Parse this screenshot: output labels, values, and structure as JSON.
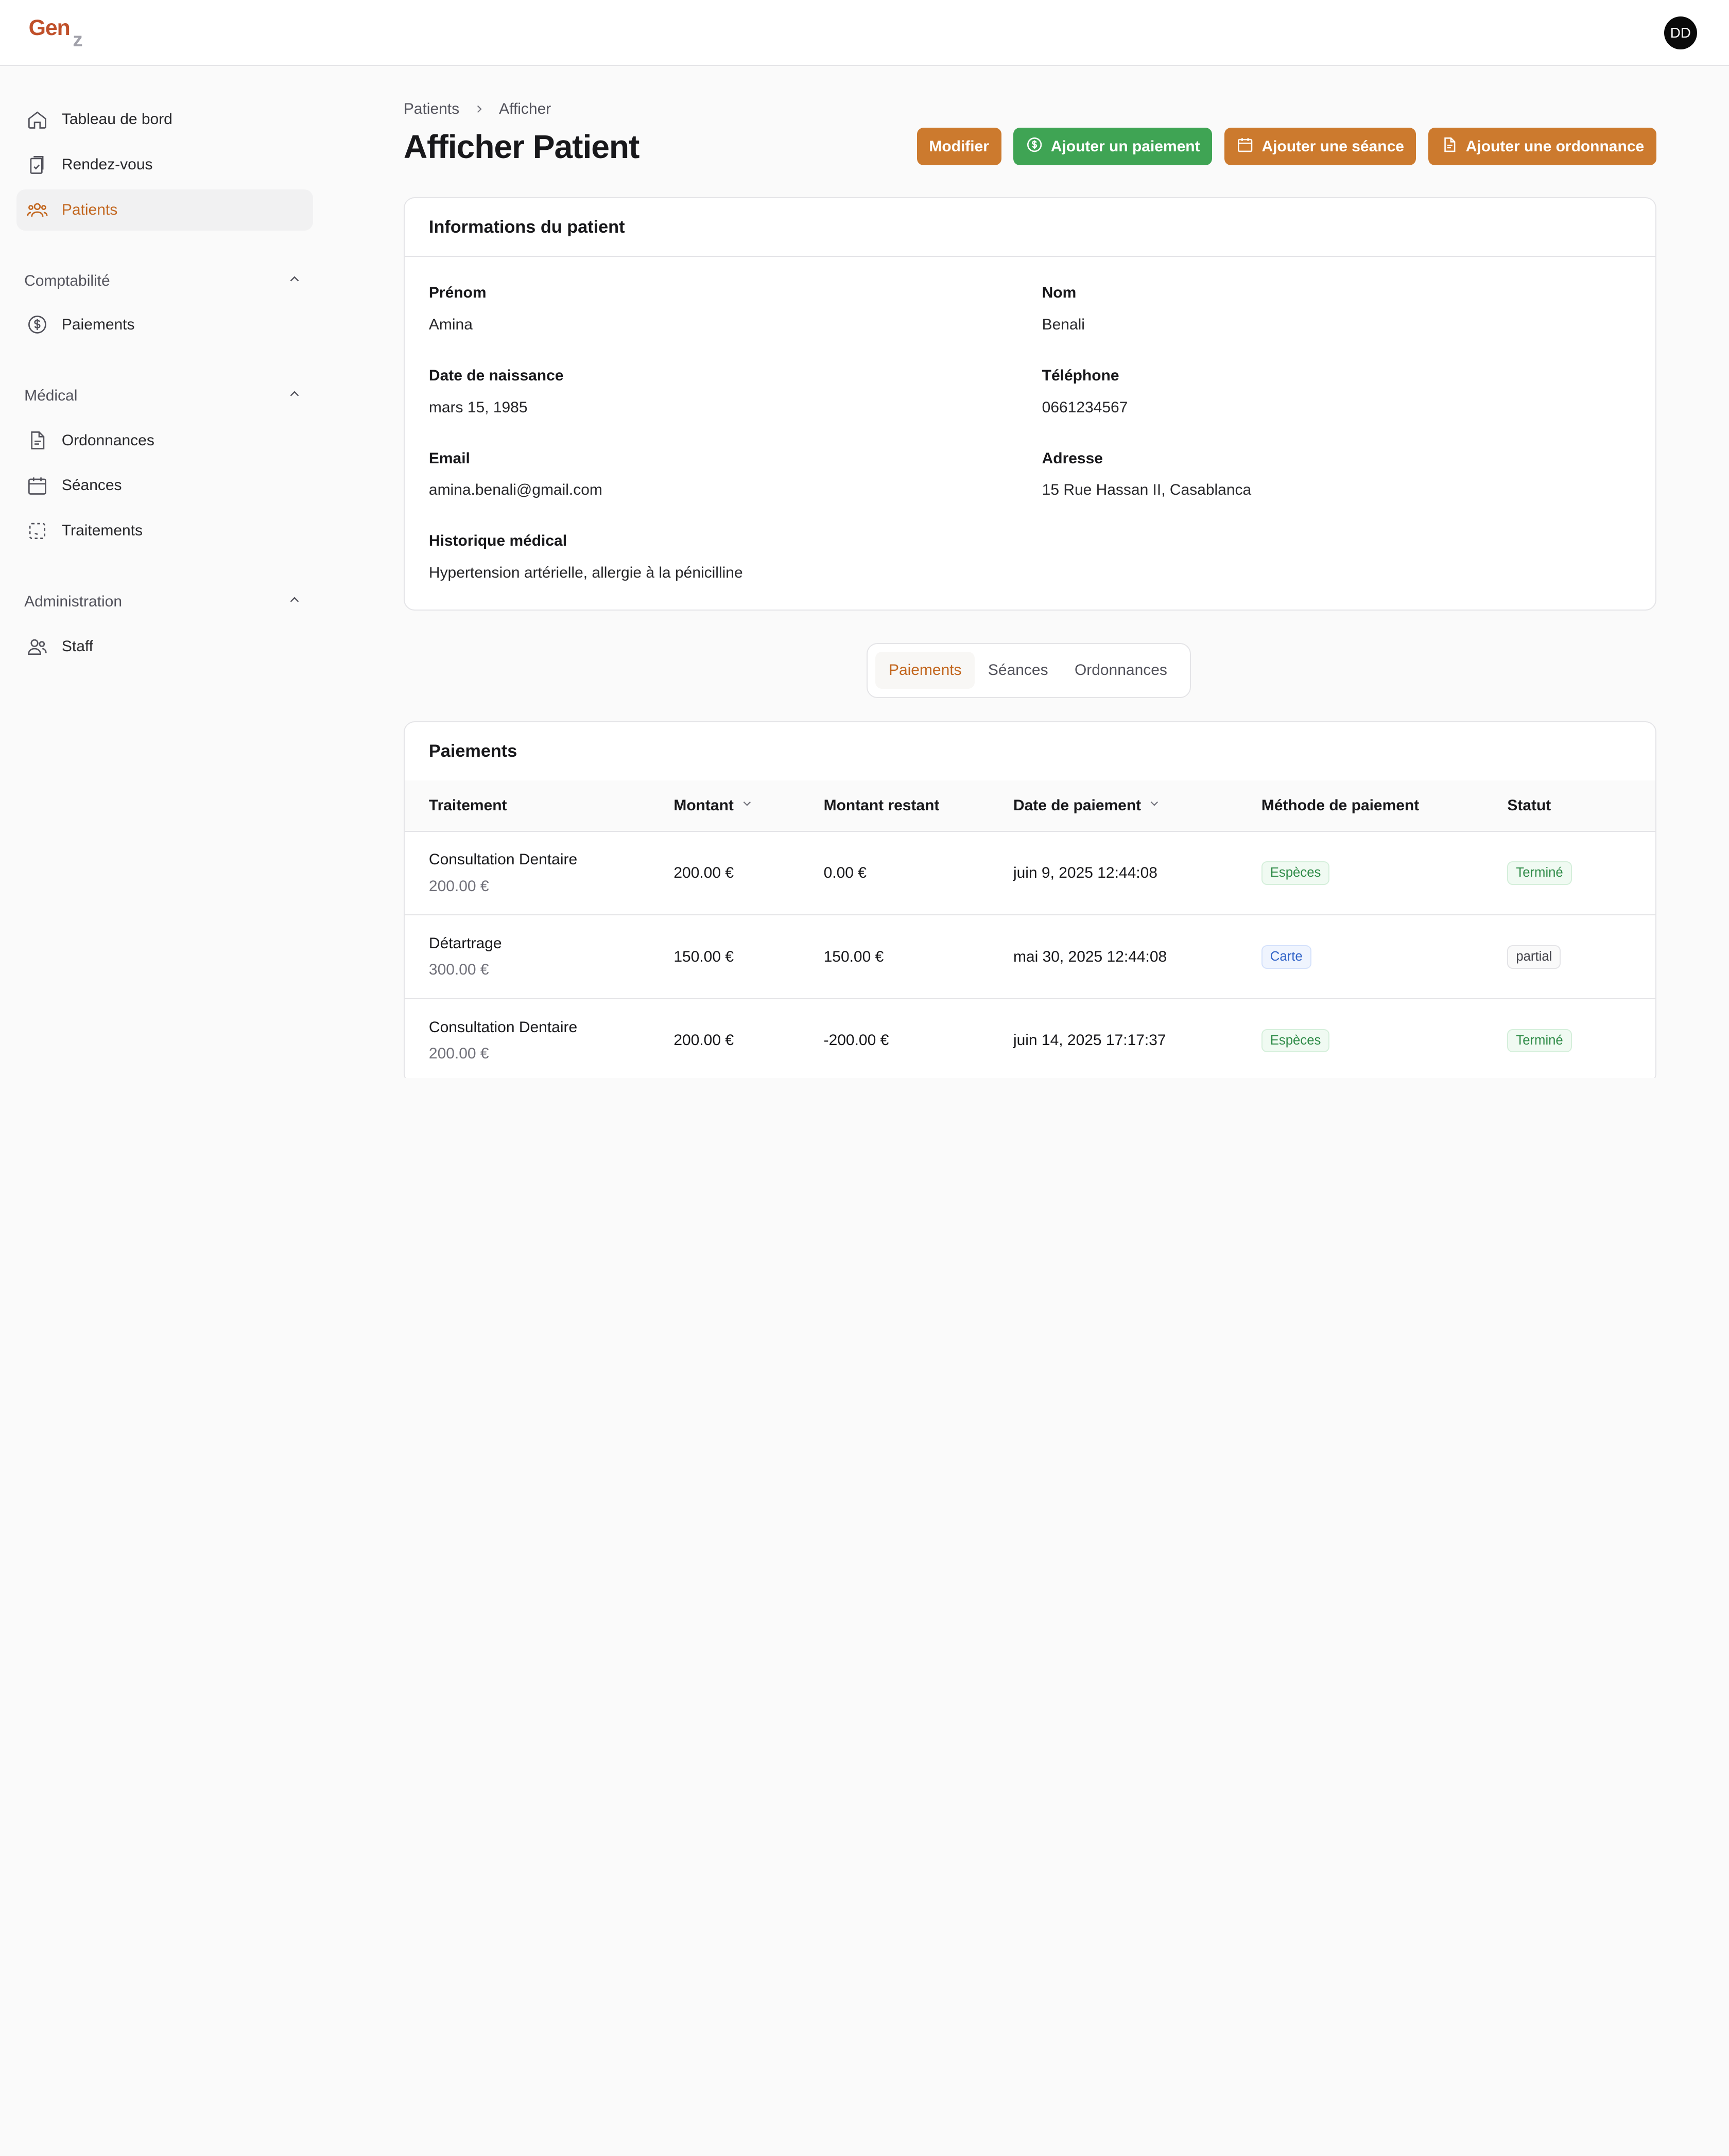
{
  "brand": {
    "logo_main": "Gen",
    "logo_sub": "z"
  },
  "user": {
    "initials": "DD"
  },
  "sidebar": {
    "items": [
      {
        "label": "Tableau de bord",
        "icon": "home-icon"
      },
      {
        "label": "Rendez-vous",
        "icon": "clipboard-check-icon"
      },
      {
        "label": "Patients",
        "icon": "users-icon",
        "active": true
      }
    ],
    "sections": [
      {
        "title": "Comptabilité",
        "items": [
          {
            "label": "Paiements",
            "icon": "dollar-circle-icon"
          }
        ]
      },
      {
        "title": "Médical",
        "items": [
          {
            "label": "Ordonnances",
            "icon": "document-icon"
          },
          {
            "label": "Séances",
            "icon": "calendar-icon"
          },
          {
            "label": "Traitements",
            "icon": "scan-icon"
          }
        ]
      },
      {
        "title": "Administration",
        "items": [
          {
            "label": "Staff",
            "icon": "staff-icon"
          }
        ]
      }
    ]
  },
  "breadcrumb": {
    "parent": "Patients",
    "current": "Afficher"
  },
  "page": {
    "title": "Afficher Patient"
  },
  "actions": {
    "edit": "Modifier",
    "add_payment": "Ajouter un paiement",
    "add_session": "Ajouter une séance",
    "add_prescription": "Ajouter une ordonnance"
  },
  "colors": {
    "accent": "#cc7a2e",
    "success": "#3fa454",
    "active_text": "#c2661e"
  },
  "patient_info": {
    "title": "Informations du patient",
    "first_name_label": "Prénom",
    "first_name": "Amina",
    "last_name_label": "Nom",
    "last_name": "Benali",
    "dob_label": "Date de naissance",
    "dob": "mars 15, 1985",
    "phone_label": "Téléphone",
    "phone": "0661234567",
    "email_label": "Email",
    "email": "amina.benali@gmail.com",
    "address_label": "Adresse",
    "address": "15 Rue Hassan II, Casablanca",
    "history_label": "Historique médical",
    "history": "Hypertension artérielle, allergie à la pénicilline"
  },
  "tabs": [
    {
      "label": "Paiements",
      "active": true
    },
    {
      "label": "Séances"
    },
    {
      "label": "Ordonnances"
    }
  ],
  "payments": {
    "title": "Paiements",
    "columns": [
      "Traitement",
      "Montant",
      "Montant restant",
      "Date de paiement",
      "Méthode de paiement",
      "Statut"
    ],
    "rows": [
      {
        "treatment": "Consultation Dentaire",
        "treatment_price": "200.00 €",
        "amount": "200.00 €",
        "remaining": "0.00 €",
        "date": "juin 9, 2025 12:44:08",
        "method": "Espèces",
        "status": "Terminé"
      },
      {
        "treatment": "Détartrage",
        "treatment_price": "300.00 €",
        "amount": "150.00 €",
        "remaining": "150.00 €",
        "date": "mai 30, 2025 12:44:08",
        "method": "Carte",
        "status": "partial"
      },
      {
        "treatment": "Consultation Dentaire",
        "treatment_price": "200.00 €",
        "amount": "200.00 €",
        "remaining": "-200.00 €",
        "date": "juin 14, 2025 17:17:37",
        "method": "Espèces",
        "status": "Terminé"
      }
    ]
  }
}
